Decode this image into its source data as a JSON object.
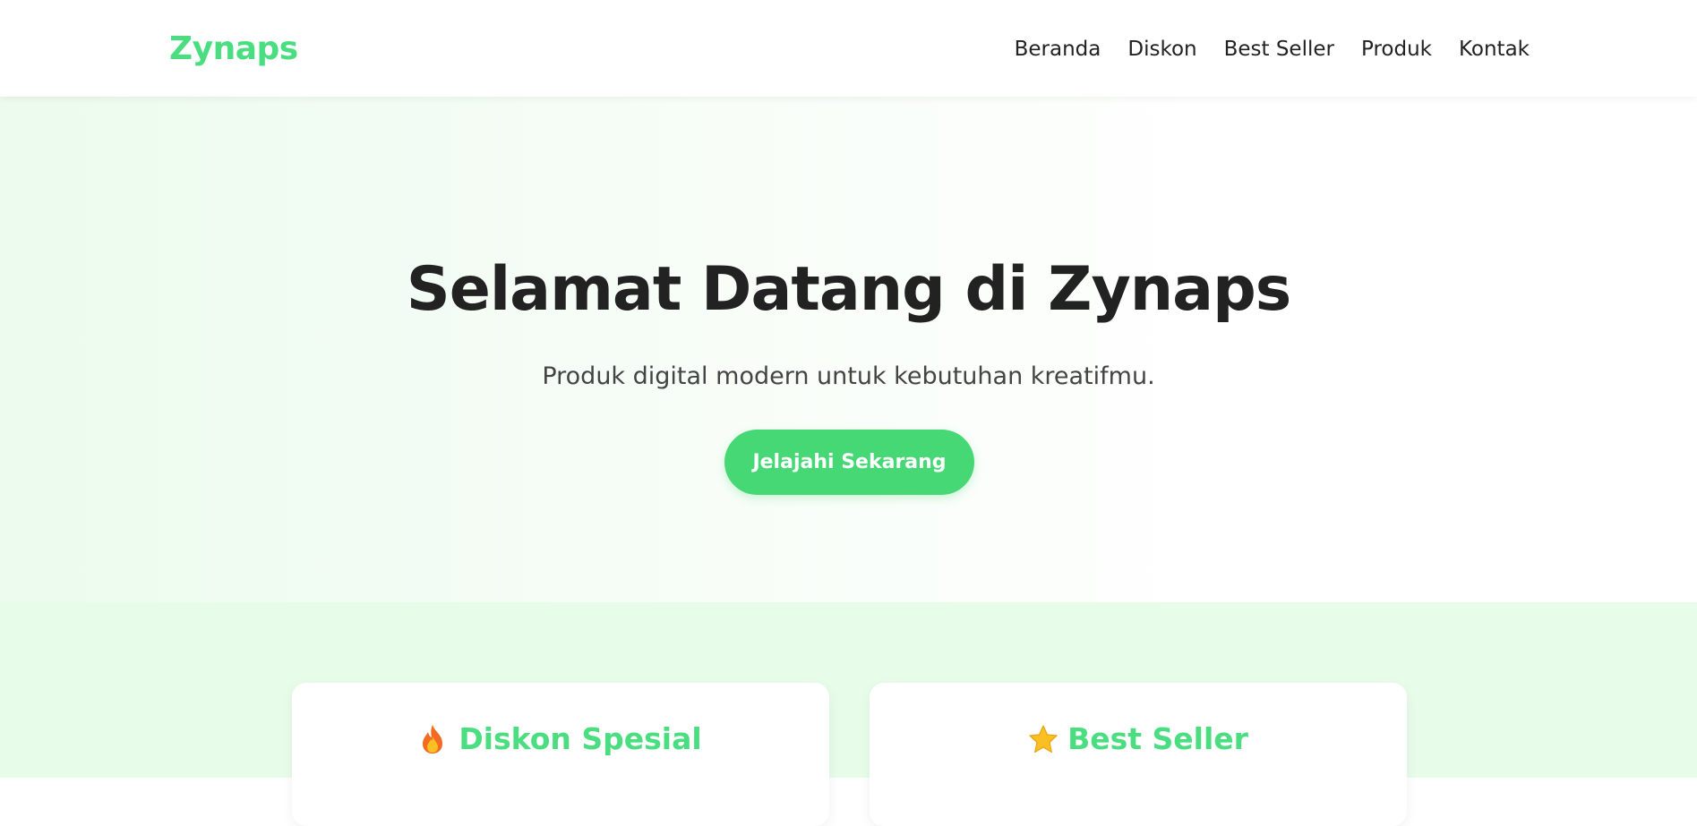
{
  "header": {
    "brand": "Zynaps",
    "nav": [
      {
        "label": "Beranda"
      },
      {
        "label": "Diskon"
      },
      {
        "label": "Best Seller"
      },
      {
        "label": "Produk"
      },
      {
        "label": "Kontak"
      }
    ]
  },
  "hero": {
    "title": "Selamat Datang di Zynaps",
    "subtitle": "Produk digital modern untuk kebutuhan kreatifmu.",
    "cta_label": "Jelajahi Sekarang"
  },
  "features": {
    "cards": [
      {
        "icon": "fire-icon",
        "title": "Diskon Spesial"
      },
      {
        "icon": "star-icon",
        "title": "Best Seller"
      }
    ]
  },
  "colors": {
    "brand": "#4ade80",
    "button": "#46d874",
    "features_bg": "#e8fde9"
  }
}
